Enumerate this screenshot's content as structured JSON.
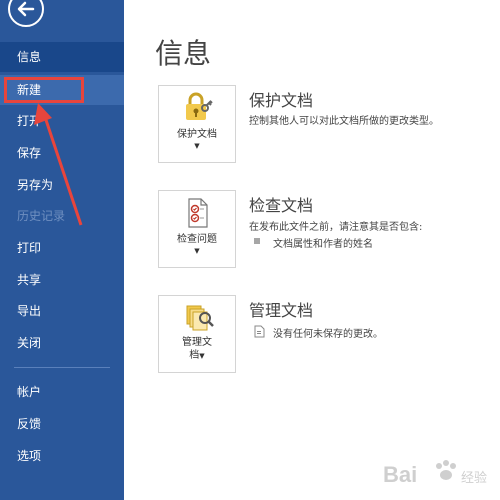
{
  "sidebar": {
    "back_label": "←",
    "items": [
      {
        "label": "信息",
        "state": "selected"
      },
      {
        "label": "新建",
        "state": "hover"
      },
      {
        "label": "打开",
        "state": "normal"
      },
      {
        "label": "保存",
        "state": "normal"
      },
      {
        "label": "另存为",
        "state": "normal"
      },
      {
        "label": "历史记录",
        "state": "disabled"
      },
      {
        "label": "打印",
        "state": "normal"
      },
      {
        "label": "共享",
        "state": "normal"
      },
      {
        "label": "导出",
        "state": "normal"
      },
      {
        "label": "关闭",
        "state": "normal"
      },
      {
        "label": "帐户",
        "state": "normal"
      },
      {
        "label": "反馈",
        "state": "normal"
      },
      {
        "label": "选项",
        "state": "normal"
      }
    ]
  },
  "main": {
    "title": "信息",
    "sections": [
      {
        "button_label": "保护文档",
        "title": "保护文档",
        "description": "控制其他人可以对此文档所做的更改类型。",
        "icon": "lock-key-icon"
      },
      {
        "button_label": "检查问题",
        "title": "检查文档",
        "description": "在发布此文件之前，请注意其是否包含:",
        "bullets": [
          "文档属性和作者的姓名"
        ],
        "icon": "inspect-document-icon"
      },
      {
        "button_label_line1": "管理文",
        "button_label_line2": "档",
        "title": "管理文档",
        "description": "没有任何未保存的更改。",
        "icon": "manage-document-icon"
      }
    ]
  },
  "watermark": {
    "text": "Bai",
    "text2": "经验"
  },
  "colors": {
    "sidebar": "#2a579a",
    "selected": "#19478a",
    "hover": "#3c6aad",
    "annotation": "#e8453c"
  }
}
